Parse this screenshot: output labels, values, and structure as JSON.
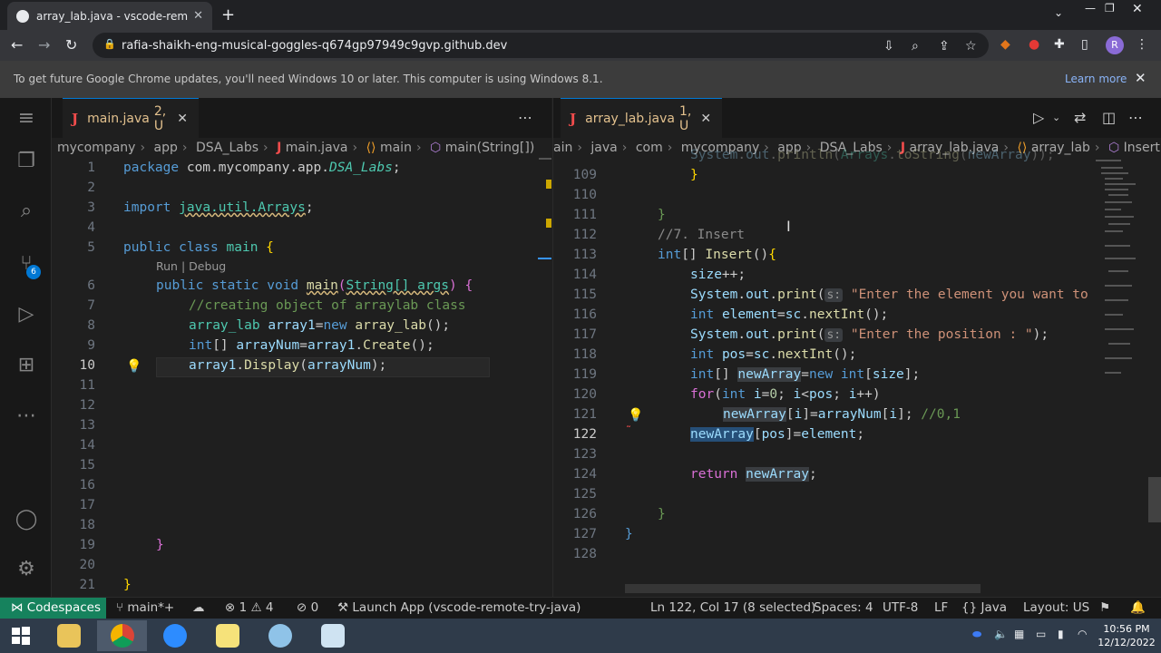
{
  "browser": {
    "tab_title": "array_lab.java - vscode-remote-tr",
    "url": "rafia-shaikh-eng-musical-goggles-q674gp97949c9gvp.github.dev",
    "infobar_message": "To get future Google Chrome updates, you'll need Windows 10 or later. This computer is using Windows 8.1.",
    "infobar_link": "Learn more",
    "profile_initial": "R"
  },
  "activity": {
    "scm_badge": "6"
  },
  "left_editor": {
    "tab": {
      "name": "main.java",
      "status": "2, U"
    },
    "breadcrumb": [
      "mycompany",
      "app",
      "DSA_Labs",
      "main.java",
      "main",
      "main(String[])"
    ],
    "codelens": "Run | Debug",
    "line_numbers": [
      "1",
      "2",
      "3",
      "4",
      "5",
      "6",
      "7",
      "8",
      "9",
      "10",
      "11",
      "12",
      "13",
      "14",
      "15",
      "16",
      "17",
      "18",
      "19",
      "20",
      "21"
    ]
  },
  "right_editor": {
    "tab": {
      "name": "array_lab.java",
      "status": "1, U"
    },
    "breadcrumb": [
      "ain",
      "java",
      "com",
      "mycompany",
      "app",
      "DSA_Labs",
      "array_lab.java",
      "array_lab",
      "Insert()"
    ],
    "line_numbers": [
      "109",
      "110",
      "111",
      "112",
      "113",
      "114",
      "115",
      "116",
      "117",
      "118",
      "119",
      "120",
      "121",
      "122",
      "123",
      "124",
      "125",
      "126",
      "127",
      "128"
    ]
  },
  "statusbar": {
    "remote": "Codespaces",
    "branch": "main*+",
    "problems_errors": "1",
    "problems_warnings": "4",
    "ports": "0",
    "launch": "Launch App (vscode-remote-try-java)",
    "cursor": "Ln 122, Col 17 (8 selected)",
    "spaces": "Spaces: 4",
    "encoding": "UTF-8",
    "eol": "LF",
    "language": "Java",
    "layout": "Layout: US"
  },
  "taskbar": {
    "time": "10:56 PM",
    "date": "12/12/2022"
  }
}
